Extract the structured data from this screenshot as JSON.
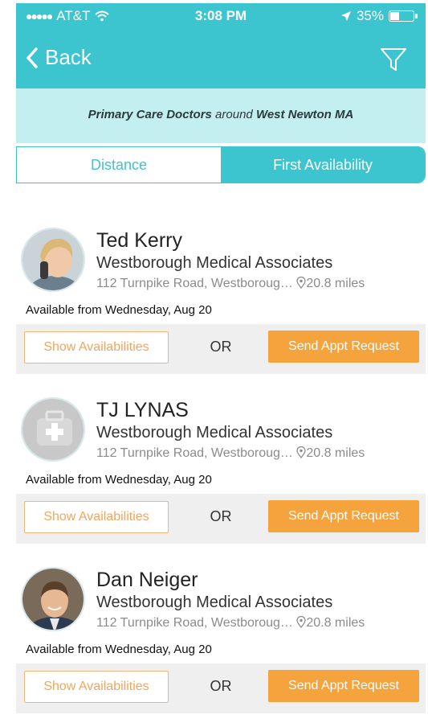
{
  "status_bar": {
    "carrier": "AT&T",
    "time": "3:08 PM",
    "battery": "35%",
    "battery_level": 0.35
  },
  "nav": {
    "back_label": "Back"
  },
  "search": {
    "specialty": "Primary Care Doctors",
    "connector": "around",
    "location": "West Newton MA"
  },
  "sort_tabs": [
    {
      "label": "Distance",
      "selected": false
    },
    {
      "label": "First Availability",
      "selected": true
    }
  ],
  "doctors": [
    {
      "name": "Ted Kerry",
      "practice": "Westborough Medical Associates",
      "address": "112 Turnpike Road, Westboroug…",
      "distance": "20.8 miles",
      "availability": "Available from Wednesday, Aug 20",
      "show_label": "Show Availabilities",
      "or_label": "OR",
      "send_label": "Send Appt Request"
    },
    {
      "name": "TJ LYNAS",
      "practice": "Westborough Medical Associates",
      "address": "112 Turnpike Road, Westboroug…",
      "distance": "20.8 miles",
      "availability": "Available from Wednesday, Aug 20",
      "show_label": "Show Availabilities",
      "or_label": "OR",
      "send_label": "Send Appt Request"
    },
    {
      "name": "Dan Neiger",
      "practice": "Westborough Medical Associates",
      "address": "112 Turnpike Road, Westboroug…",
      "distance": "20.8 miles",
      "availability": "Available from Wednesday, Aug 20",
      "show_label": "Show Availabilities",
      "or_label": "OR",
      "send_label": "Send Appt Request"
    }
  ],
  "colors": {
    "teal": "#3cc4cf",
    "light_teal": "#c4eff0",
    "orange": "#f5a33c"
  }
}
